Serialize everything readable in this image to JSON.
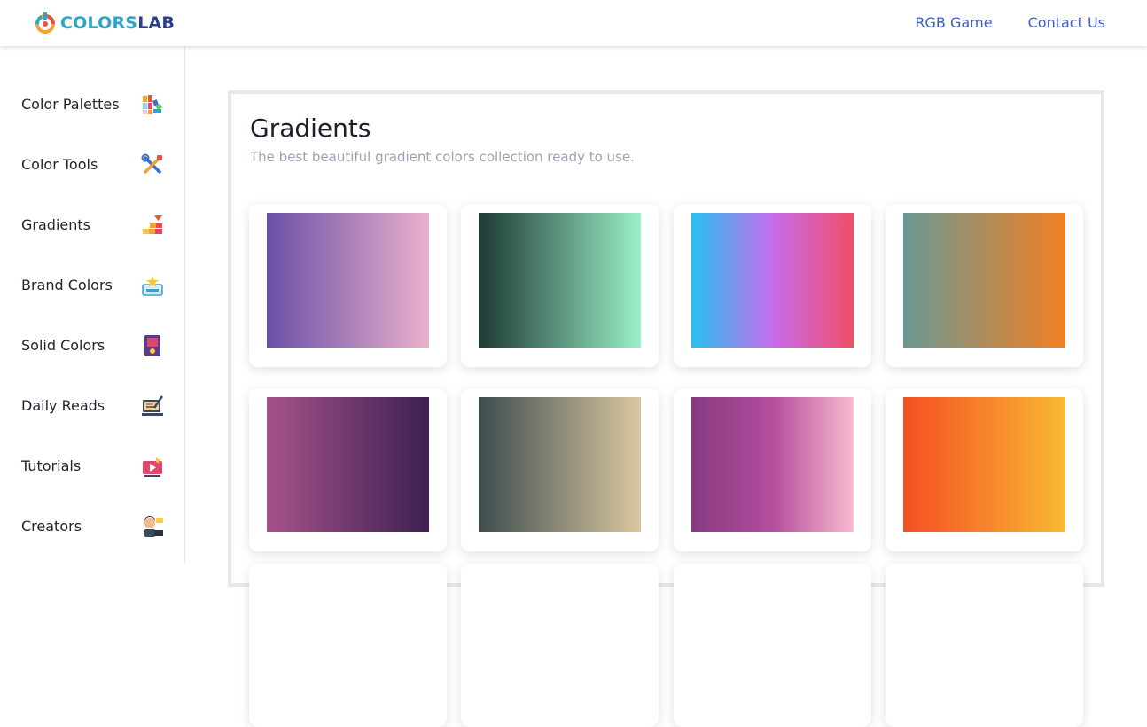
{
  "brand": {
    "part1": "COLORS",
    "part2": "LAB"
  },
  "topnav": [
    "RGB Game",
    "Contact Us"
  ],
  "sidebar": {
    "items": [
      {
        "label": "Color Palettes",
        "icon": "color-palettes-icon"
      },
      {
        "label": "Color Tools",
        "icon": "color-tools-icon"
      },
      {
        "label": "Gradients",
        "icon": "gradients-icon"
      },
      {
        "label": "Brand Colors",
        "icon": "brand-colors-icon"
      },
      {
        "label": "Solid Colors",
        "icon": "solid-colors-icon"
      },
      {
        "label": "Daily Reads",
        "icon": "daily-reads-icon"
      },
      {
        "label": "Tutorials",
        "icon": "tutorials-icon"
      },
      {
        "label": "Creators",
        "icon": "creators-icon"
      }
    ]
  },
  "main": {
    "title": "Gradients",
    "subtitle": "The best beautiful gradient colors collection ready to use.",
    "gradients": [
      {
        "colors": [
          "#6a4fa6",
          "#eab0cd"
        ]
      },
      {
        "colors": [
          "#1e3a34",
          "#9af0c8"
        ]
      },
      {
        "colors": [
          "#28c0ee",
          "#c66ceb",
          "#f24e67"
        ]
      },
      {
        "colors": [
          "#6a9994",
          "#f27f24"
        ]
      },
      {
        "colors": [
          "#a6528a",
          "#3e2052"
        ]
      },
      {
        "colors": [
          "#3d4d4e",
          "#dbc79f"
        ]
      },
      {
        "colors": [
          "#863a80",
          "#b54d9d",
          "#f9bbd0"
        ]
      },
      {
        "colors": [
          "#f44f24",
          "#f9b834"
        ]
      }
    ]
  }
}
